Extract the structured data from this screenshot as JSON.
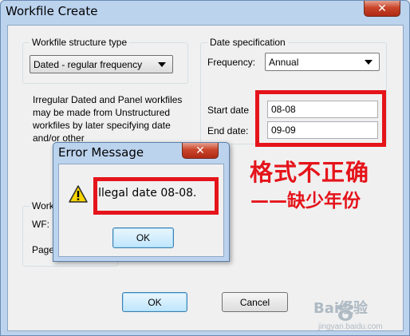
{
  "window": {
    "title": "Workfile Create",
    "close_glyph": "✕"
  },
  "structure_group": {
    "label": "Workfile structure type",
    "selected": "Dated - regular frequency",
    "info_text": "Irregular Dated and Panel workfiles may be made from Unstructured workfiles by later specifying date and/or other"
  },
  "date_group": {
    "label": "Date specification",
    "frequency_label": "Frequency:",
    "frequency_value": "Annual",
    "start_label": "Start date",
    "start_value": "08-08",
    "end_label": "End date:",
    "end_value": "09-09"
  },
  "names_group": {
    "label": "Workf",
    "wf_label": "WF:",
    "page_label": "Page"
  },
  "buttons": {
    "ok": "OK",
    "cancel": "Cancel"
  },
  "annotation": {
    "line1": "格式不正确",
    "line2": "——缺少年份",
    "color": "#e5141b"
  },
  "error_dialog": {
    "title": "Error Message",
    "close_glyph": "✕",
    "message": "Illegal date 08-08.",
    "ok": "OK",
    "icon": "warning-icon"
  },
  "watermark": {
    "text": "Bai经验",
    "subtext": "jingyan.baidu.com"
  }
}
